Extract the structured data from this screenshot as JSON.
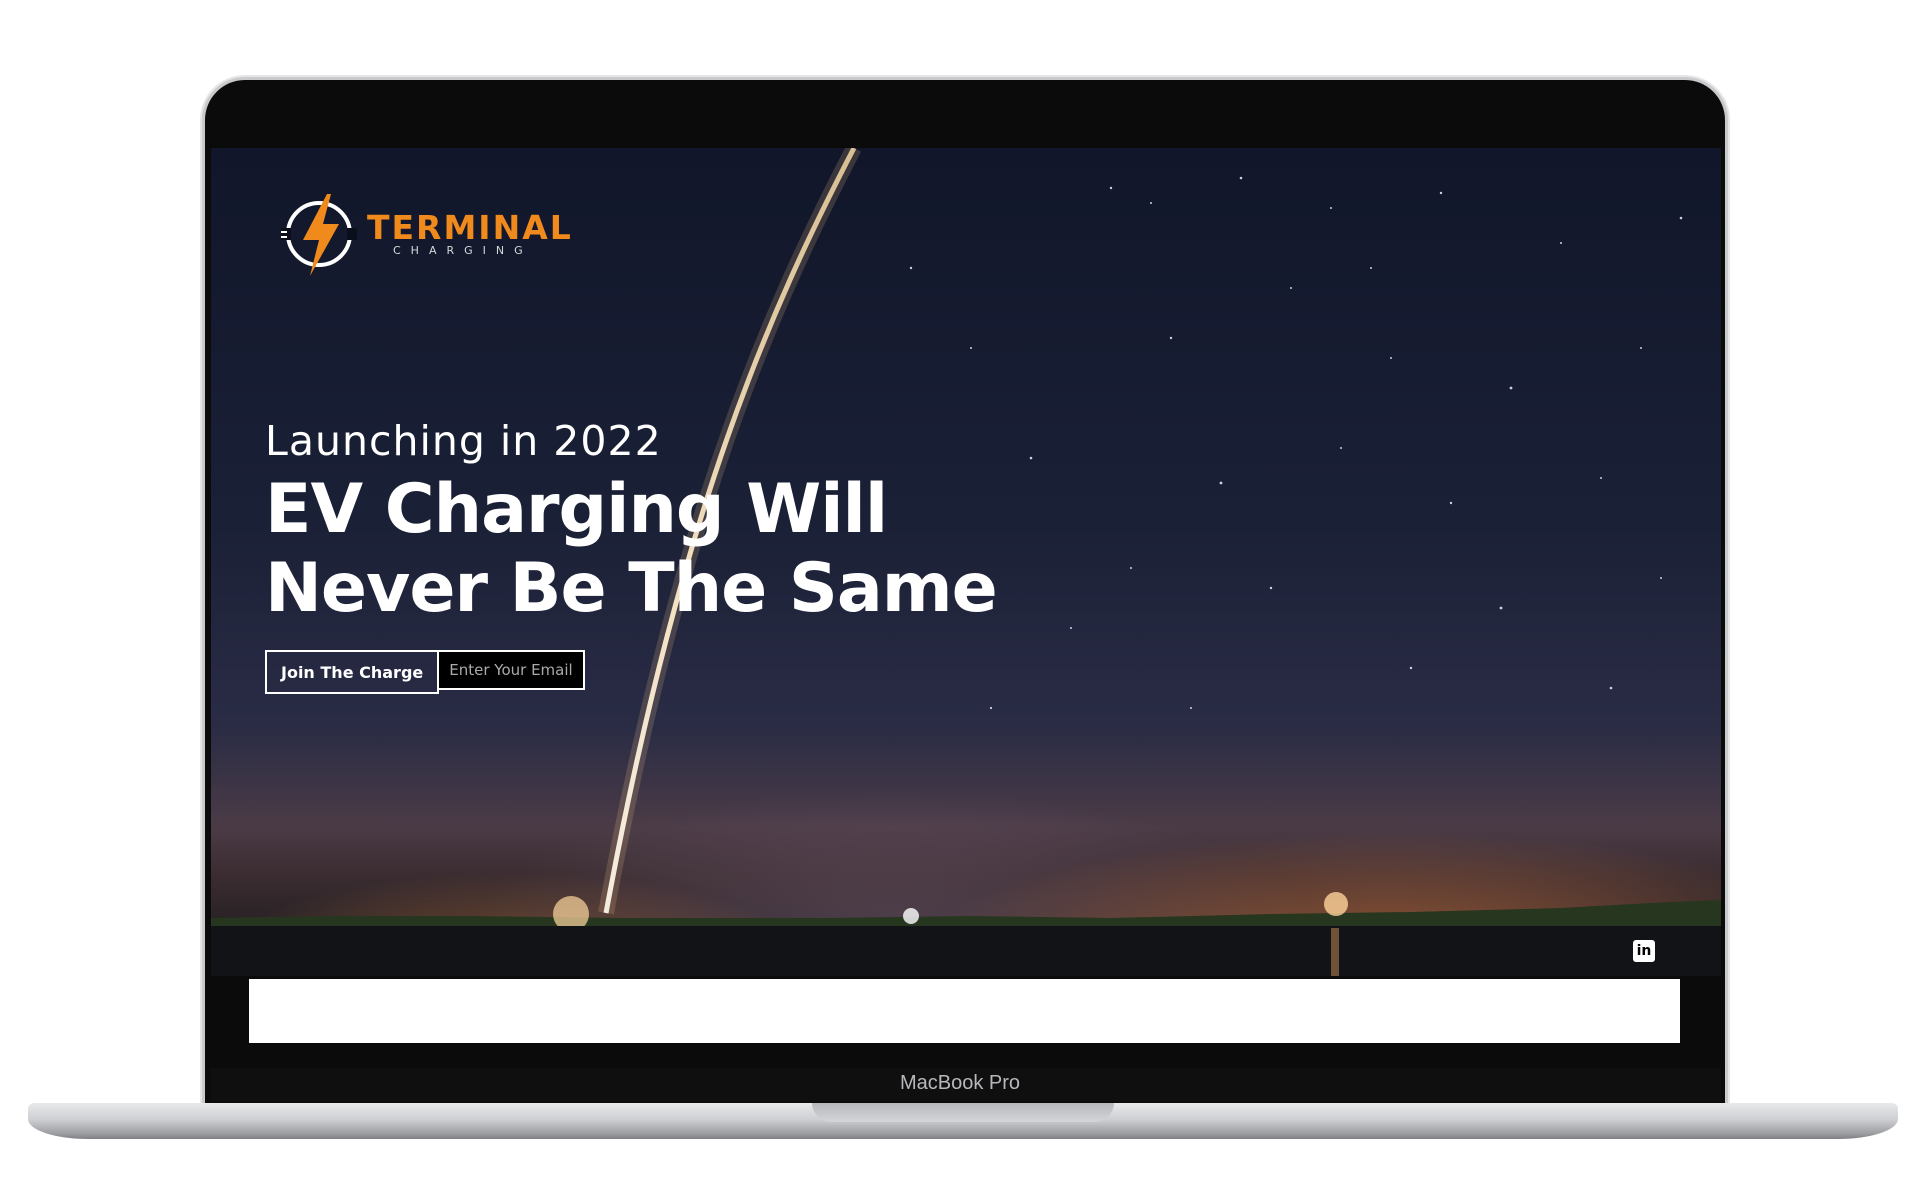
{
  "device": {
    "label": "MacBook Pro"
  },
  "site": {
    "logo": {
      "title": "TERMINAL",
      "subtitle": "CHARGING",
      "icon": "bolt-plug-icon"
    },
    "hero": {
      "kicker": "Launching in 2022",
      "headline_line1": "EV Charging Will",
      "headline_line2": "Never Be The Same"
    },
    "form": {
      "button_label": "Join The Charge",
      "email_placeholder": "Enter Your Email"
    },
    "social": {
      "linkedin_label": "in",
      "icon": "linkedin-icon"
    }
  },
  "colors": {
    "brand_orange": "#f08a1c",
    "text_white": "#ffffff"
  }
}
